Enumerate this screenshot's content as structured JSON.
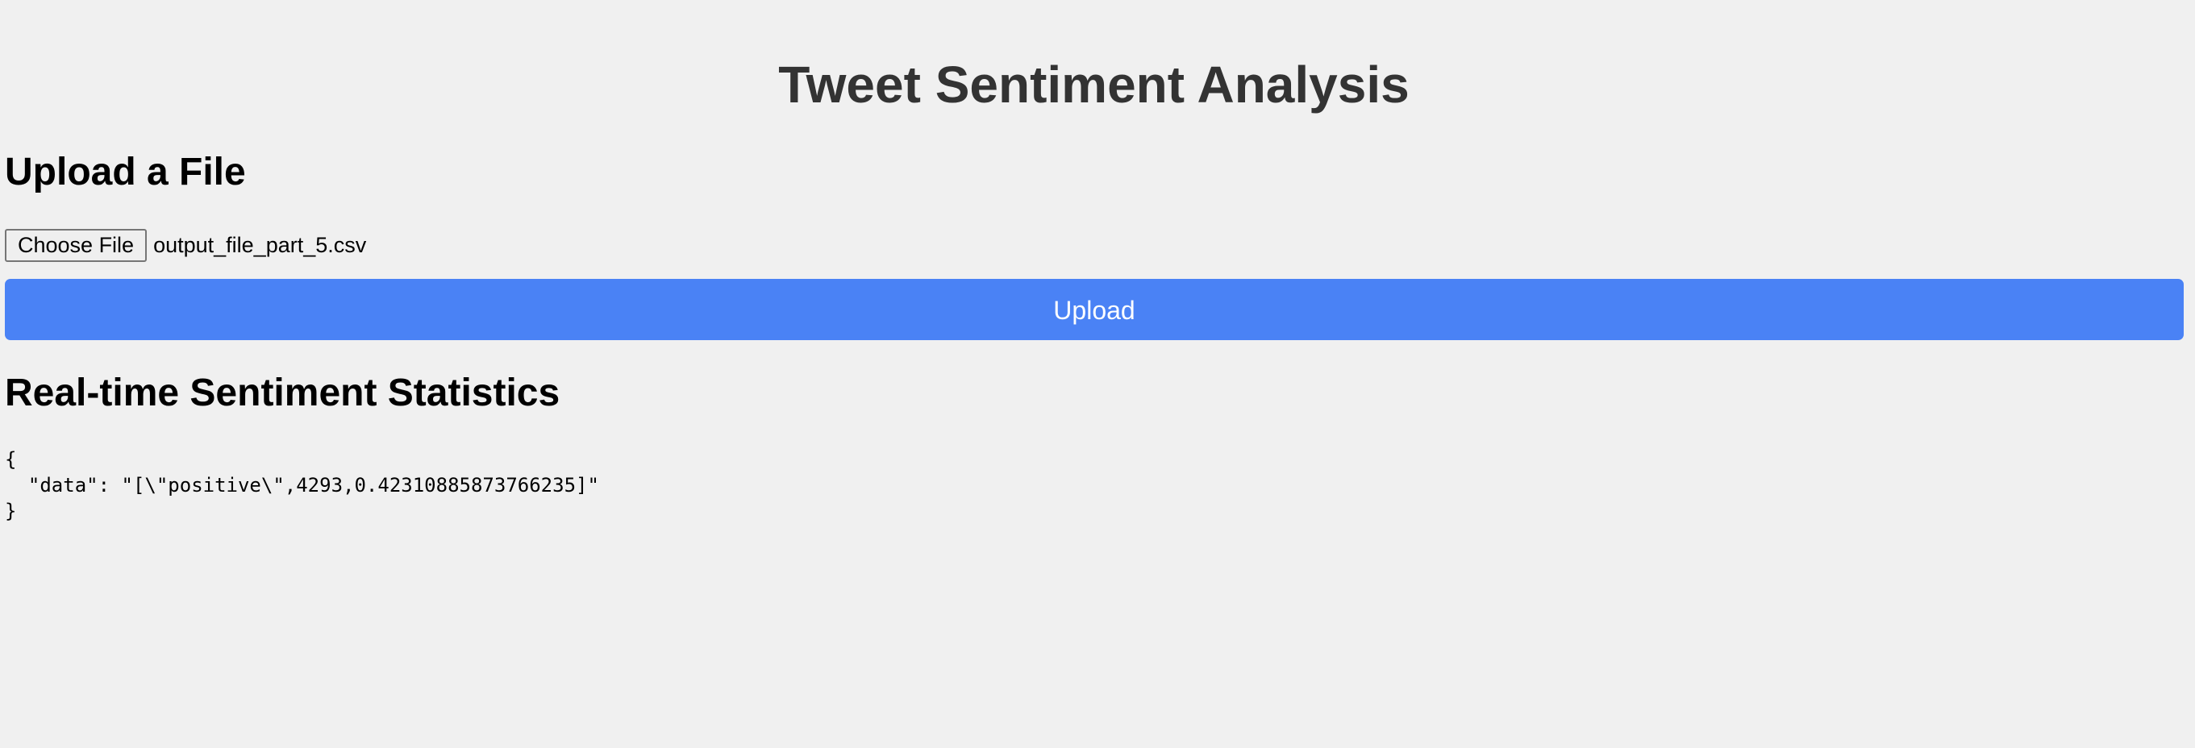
{
  "header": {
    "title": "Tweet Sentiment Analysis"
  },
  "upload": {
    "heading": "Upload a File",
    "choose_file_label": "Choose File",
    "selected_file": "output_file_part_5.csv",
    "upload_label": "Upload"
  },
  "stats": {
    "heading": "Real-time Sentiment Statistics",
    "output": "{\n  \"data\": \"[\\\"positive\\\",4293,0.42310885873766235]\"\n}"
  },
  "colors": {
    "background": "#f0f0f0",
    "title": "#333333",
    "upload_button": "#4a82f5",
    "upload_button_text": "#ffffff"
  }
}
